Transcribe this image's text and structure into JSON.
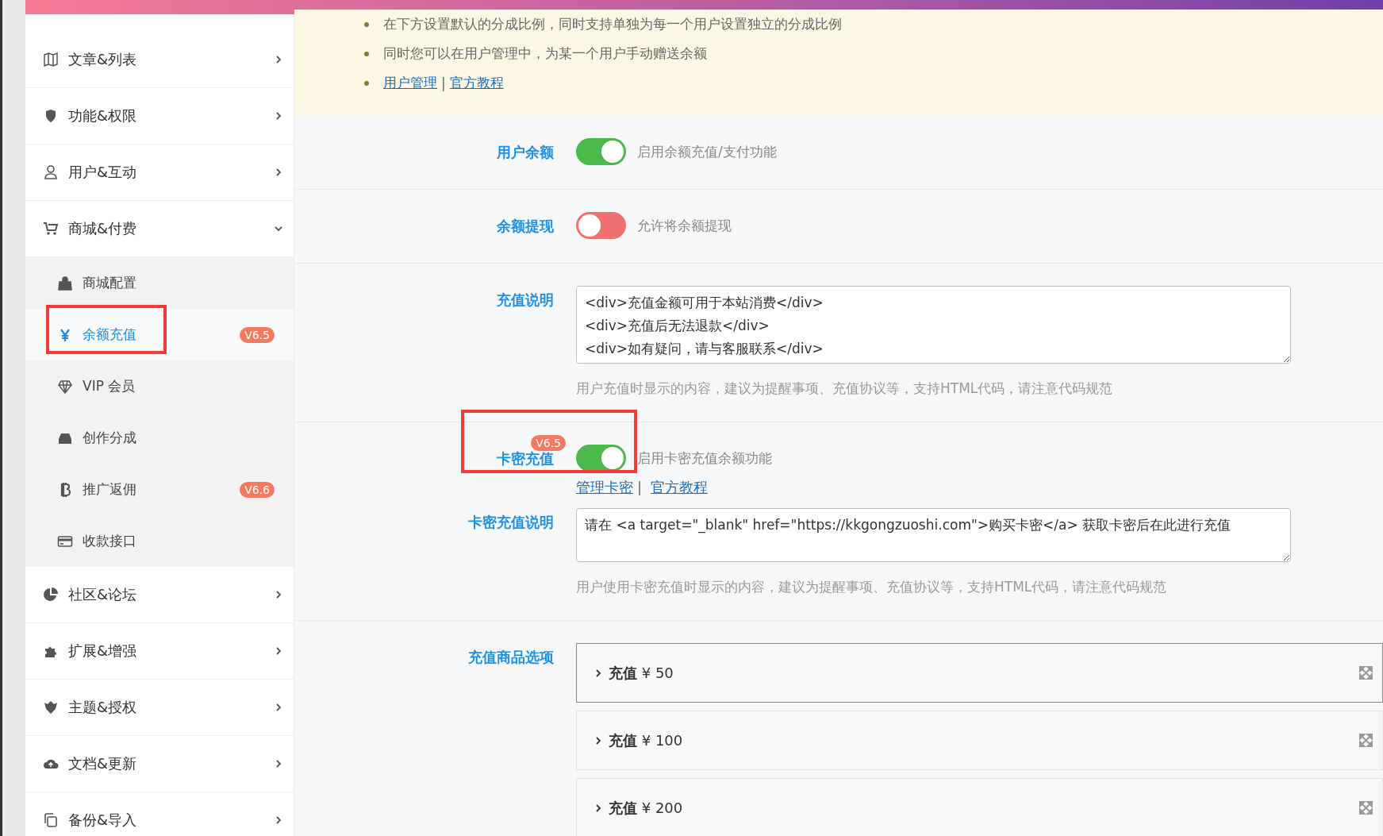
{
  "notice": {
    "bullets": [
      "在下方设置默认的分成比例，同时支持单独为每一个用户设置独立的分成比例",
      "同时您可以在用户管理中，为某一个用户手动赠送余额"
    ],
    "links": [
      "用户管理",
      "官方教程"
    ],
    "separator": "|"
  },
  "sidebar": {
    "items": [
      {
        "label": "文章&列表",
        "expanded": false
      },
      {
        "label": "功能&权限",
        "expanded": false
      },
      {
        "label": "用户&互动",
        "expanded": false
      },
      {
        "label": "商城&付费",
        "expanded": true,
        "children": [
          {
            "label": "商城配置",
            "selected": false,
            "highlighted": false
          },
          {
            "label": "余额充值",
            "selected": true,
            "badge": "V6.5",
            "highlighted": true
          },
          {
            "label": "VIP 会员",
            "selected": false,
            "highlighted": false
          },
          {
            "label": "创作分成",
            "selected": false,
            "highlighted": false
          },
          {
            "label": "推广返佣",
            "selected": false,
            "badge": "V6.6",
            "highlighted": false
          },
          {
            "label": "收款接口",
            "selected": false,
            "highlighted": false
          }
        ]
      },
      {
        "label": "社区&论坛",
        "expanded": false
      },
      {
        "label": "扩展&增强",
        "expanded": false
      },
      {
        "label": "主题&授权",
        "expanded": false
      },
      {
        "label": "文档&更新",
        "expanded": false
      },
      {
        "label": "备份&导入",
        "expanded": false
      }
    ]
  },
  "sections": [
    {
      "fields": [
        {
          "kind": "toggle",
          "label": "用户余额",
          "on": true,
          "text": "启用余额充值/支付功能"
        }
      ]
    },
    {
      "fields": [
        {
          "kind": "toggle",
          "label": "余额提现",
          "on": false,
          "text": "允许将余额提现"
        }
      ]
    },
    {
      "fields": [
        {
          "kind": "textarea",
          "label": "充值说明",
          "value": "<div>充值金额可用于本站消费</div>\n<div>充值后无法退款</div>\n<div>如有疑问，请与客服联系</div>",
          "help": "用户充值时显示的内容，建议为提醒事项、充值协议等，支持HTML代码，请注意代码规范"
        }
      ]
    },
    {
      "fields": [
        {
          "kind": "toggle",
          "label": "卡密充值",
          "badge": "V6.5",
          "highlighted": true,
          "on": true,
          "text": "启用卡密充值余额功能",
          "links": [
            "管理卡密",
            "官方教程"
          ],
          "separator": "|"
        },
        {
          "kind": "textarea",
          "label": "卡密充值说明",
          "value": "请在 <a target=\"_blank\" href=\"https://kkgongzuoshi.com\">购买卡密</a> 获取卡密后在此进行充值",
          "help": "用户使用卡密充值时显示的内容，建议为提醒事项、充值协议等，支持HTML代码，请注意代码规范"
        }
      ]
    },
    {
      "fields": [
        {
          "kind": "accordion",
          "label": "充值商品选项",
          "items": [
            {
              "title": "**充值** ¥ 50",
              "selected": true
            },
            {
              "title": "**充值** ¥ 100",
              "selected": false
            },
            {
              "title": "**充值** ¥ 200",
              "selected": false
            }
          ]
        }
      ]
    }
  ]
}
